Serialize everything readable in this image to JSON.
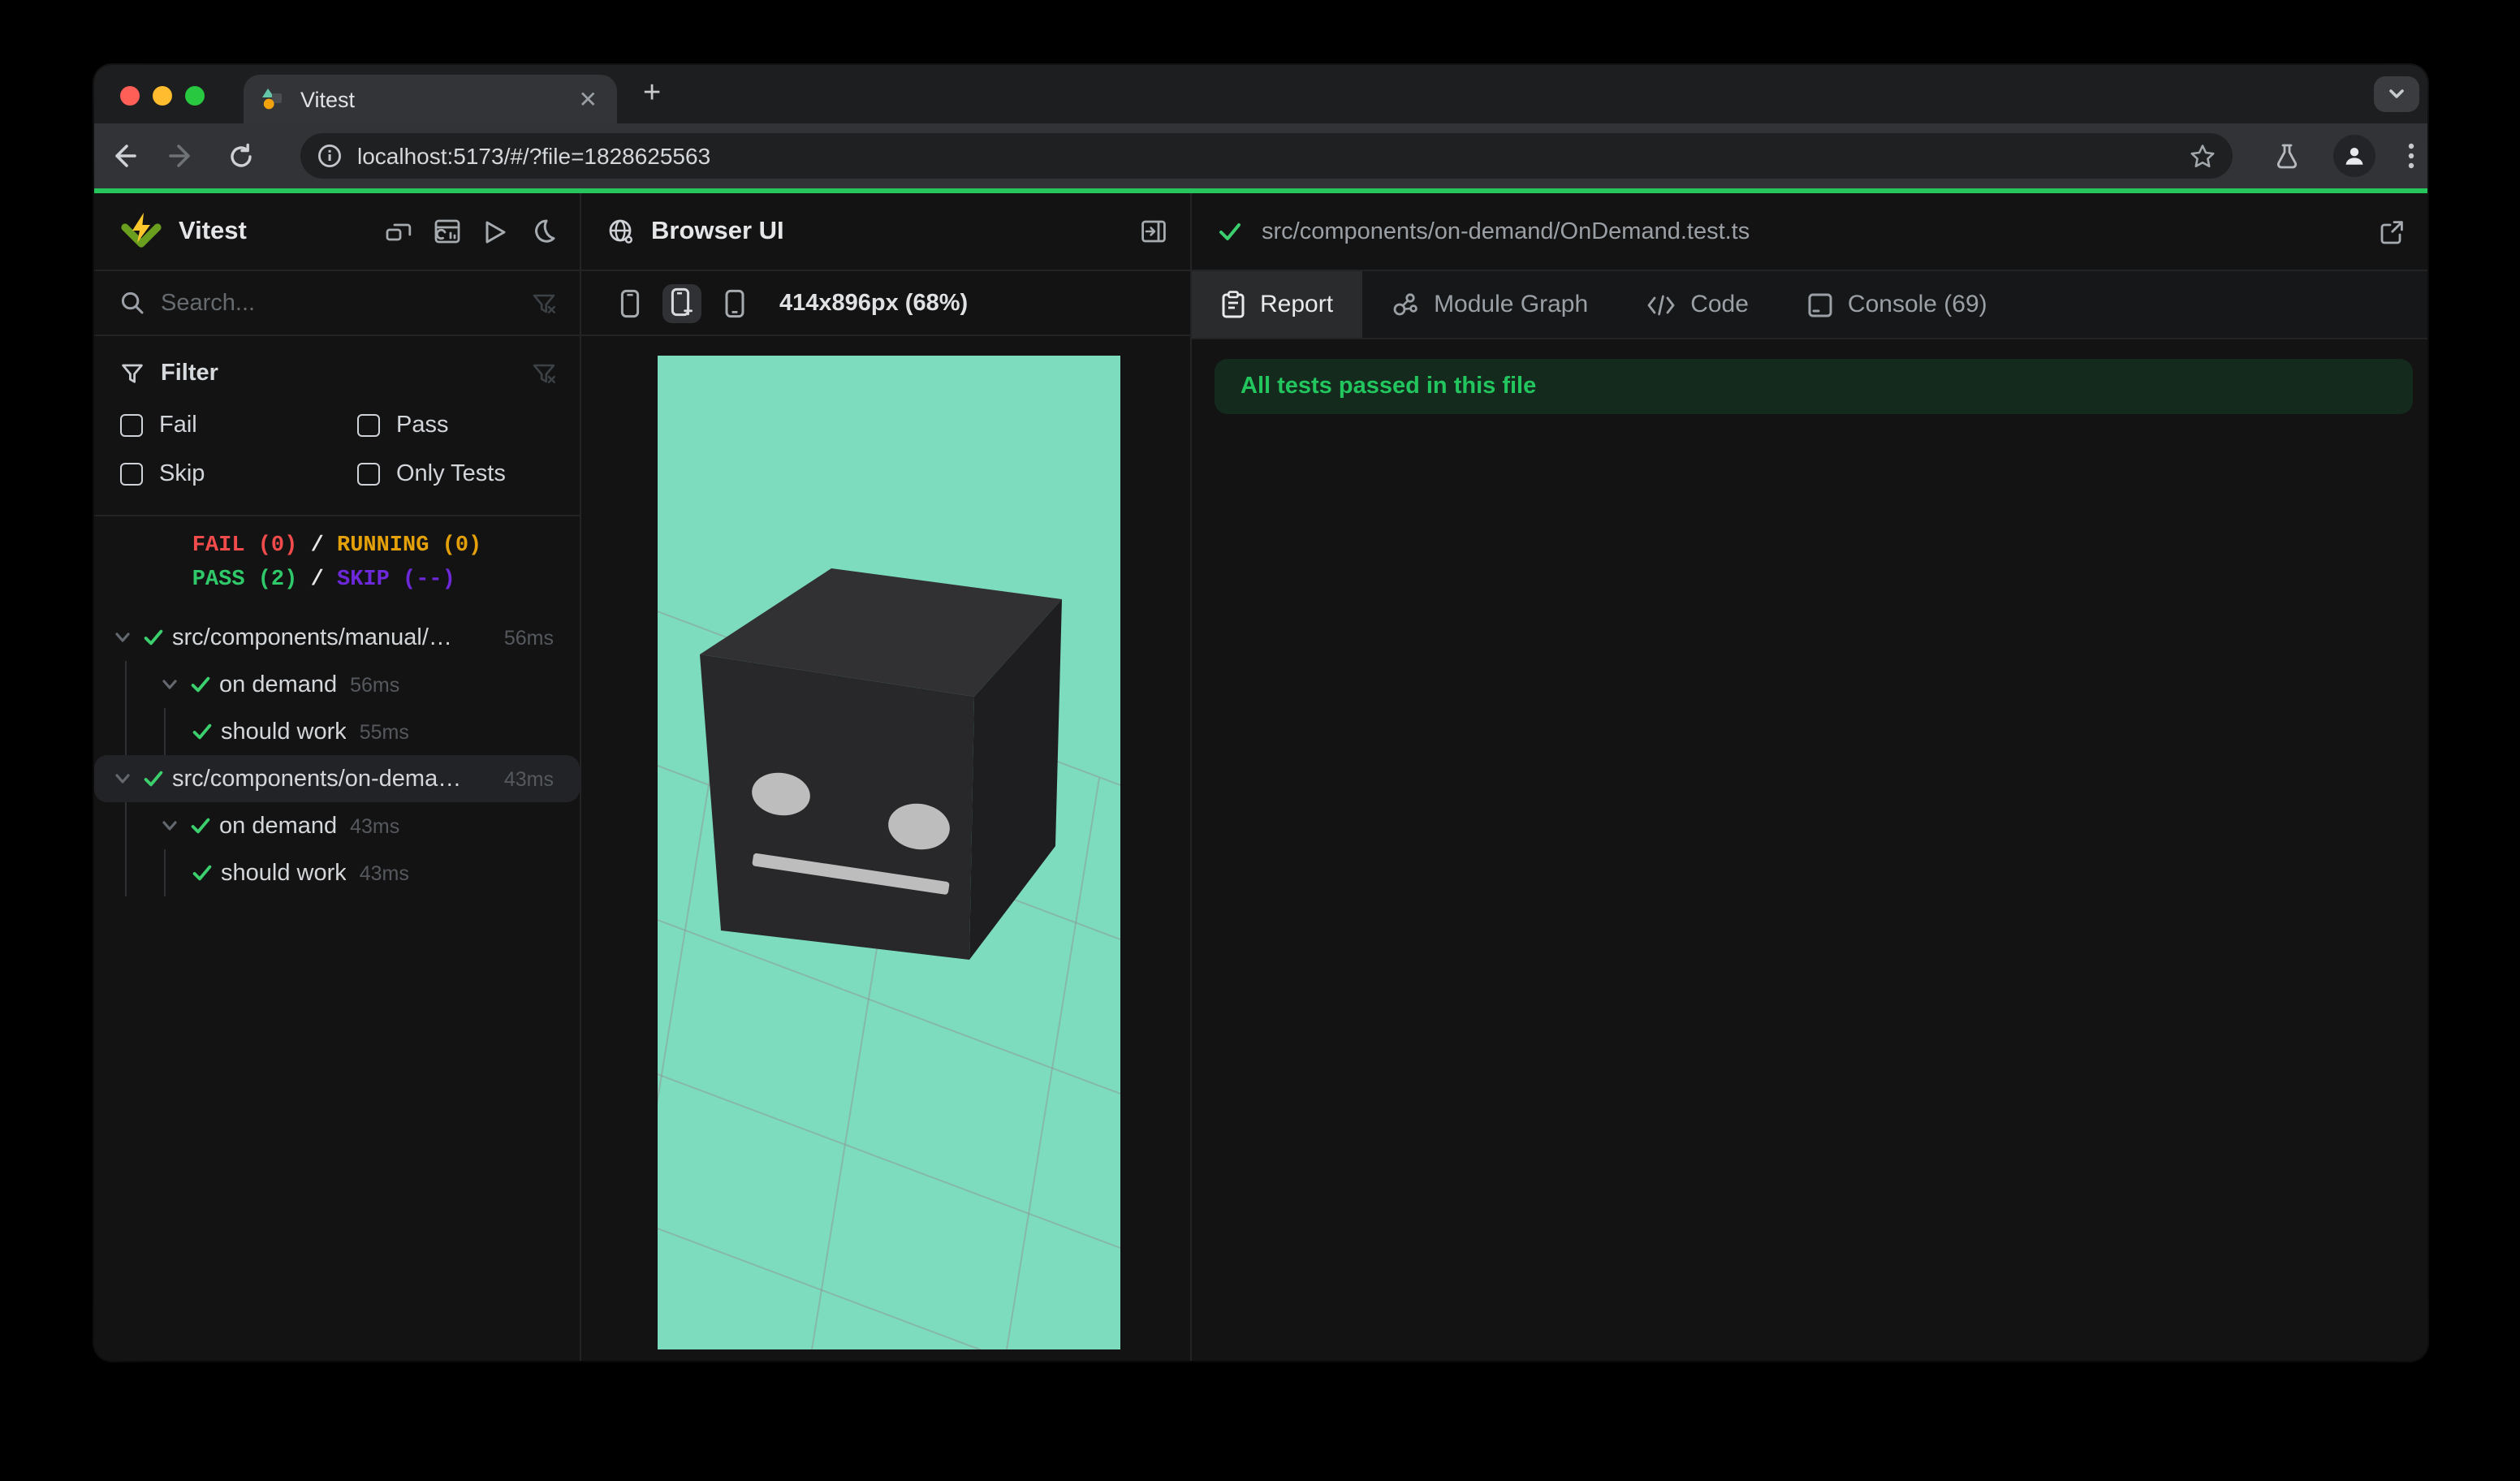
{
  "browser": {
    "tab_title": "Vitest",
    "url": "localhost:5173/#/?file=1828625563",
    "close_glyph": "✕",
    "new_tab_glyph": "+"
  },
  "sidebar": {
    "title": "Vitest",
    "search_placeholder": "Search...",
    "filter": {
      "title": "Filter",
      "options": [
        "Fail",
        "Pass",
        "Skip",
        "Only Tests"
      ]
    },
    "stats": {
      "fail": "FAIL (0)",
      "running": "RUNNING (0)",
      "pass": "PASS (2)",
      "skip": "SKIP (--)",
      "separator": "/"
    },
    "tree": [
      {
        "label": "src/components/manual/…",
        "duration": "56ms",
        "type": "file"
      },
      {
        "label": "on demand",
        "duration": "56ms",
        "type": "suite"
      },
      {
        "label": "should work",
        "duration": "55ms",
        "type": "test"
      },
      {
        "label": "src/components/on-dema…",
        "duration": "43ms",
        "type": "file",
        "selected": true
      },
      {
        "label": "on demand",
        "duration": "43ms",
        "type": "suite"
      },
      {
        "label": "should work",
        "duration": "43ms",
        "type": "test"
      }
    ]
  },
  "preview": {
    "title": "Browser UI",
    "viewport_label": "414x896px (68%)"
  },
  "detail": {
    "file_path": "src/components/on-demand/OnDemand.test.ts",
    "tabs": [
      "Report",
      "Module Graph",
      "Code",
      "Console (69)"
    ],
    "banner": "All tests passed in this file"
  },
  "colors": {
    "accent_green": "#26c65c",
    "pass_green": "#2fc96a",
    "fail_red": "#f24b4b",
    "running_amber": "#e3a008",
    "skip_purple": "#6d28d9",
    "banner_bg": "#142a1c",
    "banner_text": "#22c55e",
    "canvas_teal": "#7edcbe",
    "grid_line": "#8a9a98",
    "traffic_red": "#ff5f57",
    "traffic_yellow": "#febc2e",
    "traffic_green": "#28c840"
  },
  "icons": [
    "vitest-logo",
    "search",
    "funnel",
    "funnel-clear",
    "collapse-windows",
    "dashboard",
    "run-all",
    "dark-mode-moon",
    "globe",
    "collapse-panel",
    "phone-small",
    "phone-add",
    "phone-rotate",
    "check",
    "chevron-down",
    "report-clipboard",
    "module-graph",
    "code",
    "console",
    "external-link",
    "back-arrow",
    "forward-arrow",
    "reload",
    "page-info",
    "bookmark-star",
    "lab-flask",
    "profile",
    "menu-kebab",
    "tab-search-chevron"
  ]
}
